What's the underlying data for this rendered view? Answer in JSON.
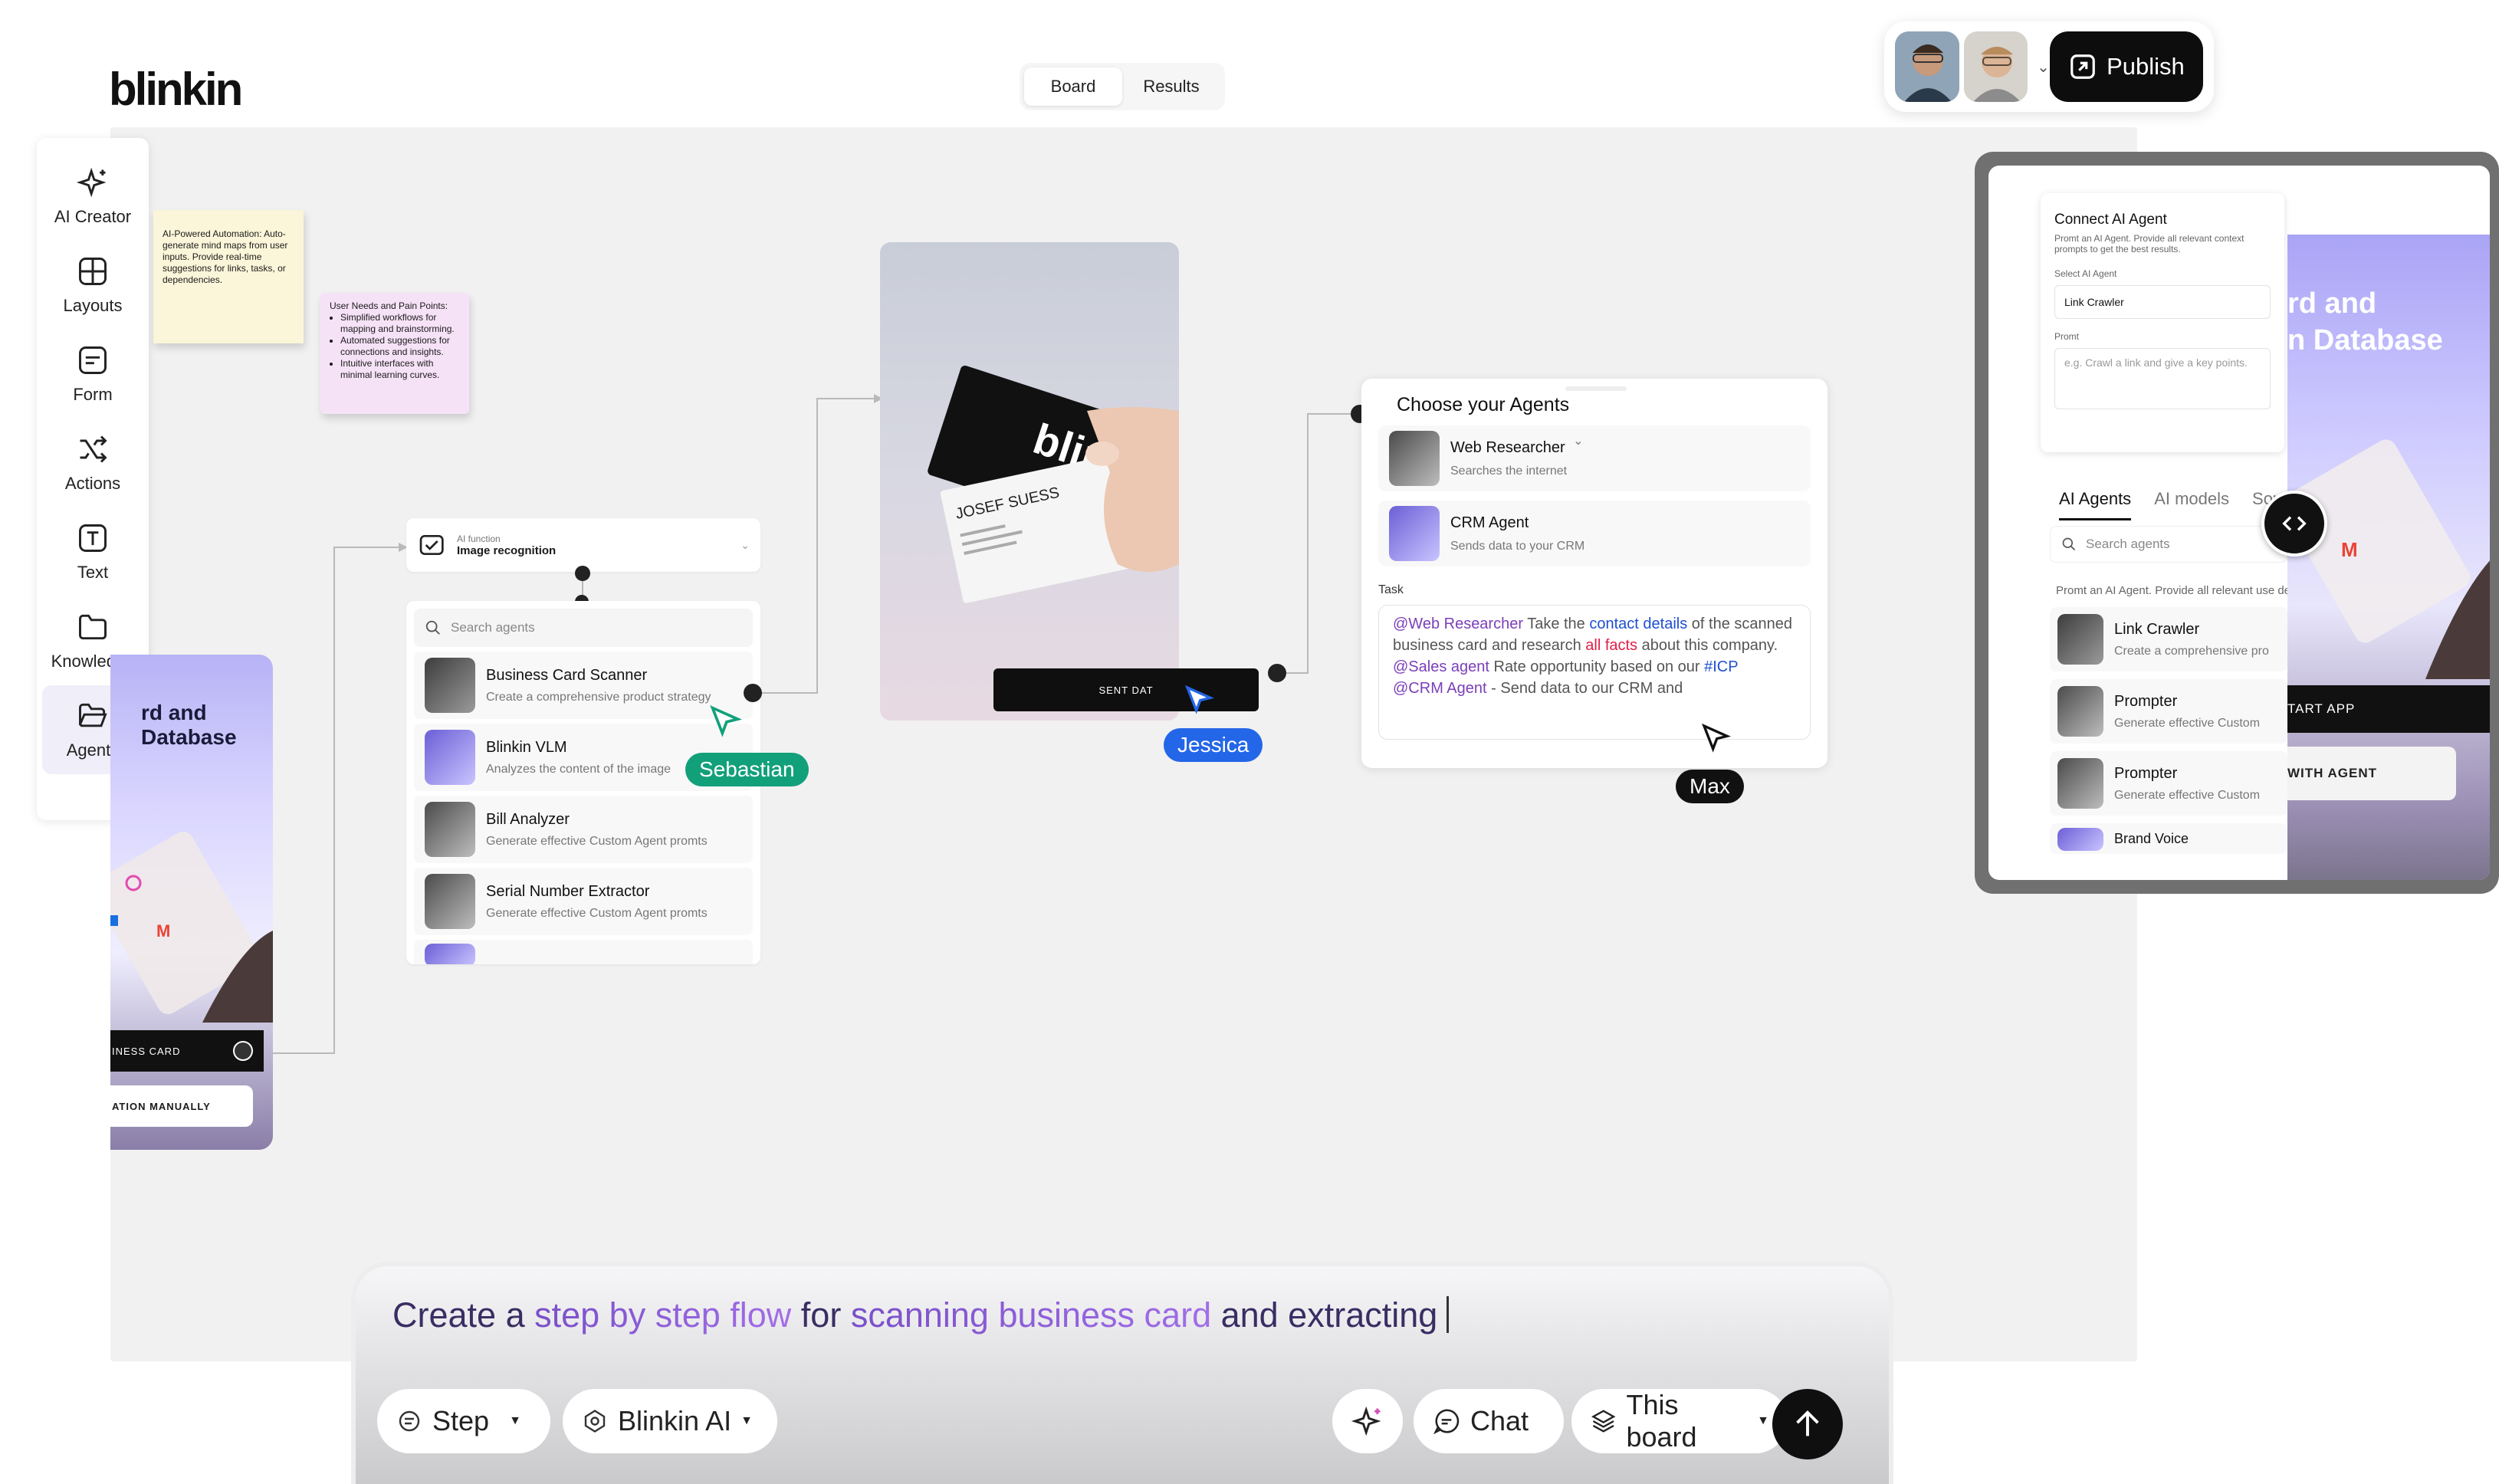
{
  "app": {
    "logo": "blinkin"
  },
  "top_tabs": [
    {
      "label": "Board",
      "active": true
    },
    {
      "label": "Results",
      "active": false
    }
  ],
  "publish": {
    "label": "Publish"
  },
  "sidebar": {
    "items": [
      {
        "label": "AI Creator",
        "icon": "sparkle-icon"
      },
      {
        "label": "Layouts",
        "icon": "layout-icon"
      },
      {
        "label": "Form",
        "icon": "form-icon"
      },
      {
        "label": "Actions",
        "icon": "shuffle-icon"
      },
      {
        "label": "Text",
        "icon": "text-icon"
      },
      {
        "label": "Knowledge",
        "icon": "folder-icon"
      },
      {
        "label": "Agents",
        "icon": "folder-open-icon",
        "active": true
      }
    ]
  },
  "sticky1": {
    "text": "AI-Powered Automation: Auto-generate mind maps from user inputs. Provide real-time suggestions for links, tasks, or dependencies."
  },
  "sticky2": {
    "title": "User Needs and Pain Points:",
    "items": [
      "Simplified workflows for mapping and brainstorming.",
      "Automated suggestions for connections and insights.",
      "Intuitive interfaces with minimal learning curves."
    ]
  },
  "phone_left": {
    "title_a": "rd and",
    "title_b": "Database",
    "btn1": "INESS CARD",
    "btn2": "ATION MANUALLY"
  },
  "ai_function": {
    "small": "AI function",
    "title": "Image recognition"
  },
  "agent_list": {
    "search_placeholder": "Search agents",
    "rows": [
      {
        "name": "Business Card Scanner",
        "desc": "Create a comprehensive product strategy"
      },
      {
        "name": "Blinkin VLM",
        "desc": "Analyzes the content of the image"
      },
      {
        "name": "Bill Analyzer",
        "desc": "Generate effective Custom Agent promts"
      },
      {
        "name": "Serial Number Extractor",
        "desc": "Generate effective Custom Agent promts"
      }
    ]
  },
  "business_card": {
    "brand": "blinkin",
    "person": "JOSEF SUESS"
  },
  "sent_button": {
    "label": "SENT DAT"
  },
  "cursors": {
    "sebastian": "Sebastian",
    "jessica": "Jessica",
    "max": "Max"
  },
  "choose_agents": {
    "title": "Choose your Agents",
    "rows": [
      {
        "name": "Web Researcher",
        "desc": "Searches the internet"
      },
      {
        "name": "CRM Agent",
        "desc": "Sends data to your CRM"
      }
    ],
    "task_label": "Task",
    "task": {
      "m1": "@Web Researcher",
      "t1": " Take the ",
      "m2": "contact details",
      "t2": " of the scanned business card and research ",
      "m3": "all facts",
      "t3": " about this company.",
      "m4": "@Sales agent",
      "t4": " Rate opportunity based on  our ",
      "m5": "#ICP",
      "m6": "@CRM Agent",
      "t5": " - Send data to our CRM and"
    }
  },
  "right_panel": {
    "card_title": "Connect AI Agent",
    "card_desc": "Promt an AI Agent. Provide all relevant context prompts to get the best results.",
    "select_label": "Select AI Agent",
    "select_value": "Link Crawler",
    "prompt_label": "Promt",
    "prompt_placeholder": "e.g. Crawl a link and give a key points.",
    "tabs": [
      {
        "label": "AI Agents",
        "active": true
      },
      {
        "label": "AI models"
      },
      {
        "label": "Sour"
      }
    ],
    "search_placeholder": "Search agents",
    "hint": "Promt an AI Agent. Provide all relevant use detailed prompts to get the best",
    "rows": [
      {
        "name": "Link Crawler",
        "desc": "Create a comprehensive pro"
      },
      {
        "name": "Prompter",
        "desc": "Generate effective Custom"
      },
      {
        "name": "Prompter",
        "desc": "Generate effective Custom"
      },
      {
        "name": "Brand Voice",
        "desc": ""
      }
    ],
    "phone_title_a": "rd and",
    "phone_title_b": "n Database",
    "phone_btn1": "TART APP",
    "phone_btn2": "WITH AGENT"
  },
  "prompt": {
    "t1": "Create a ",
    "g1": "step by step flow",
    "t2": " for ",
    "g2": "scanning business card",
    "t3": " and extracting",
    "step": "Step",
    "model": "Blinkin AI",
    "chat": "Chat",
    "scope": "This board"
  }
}
